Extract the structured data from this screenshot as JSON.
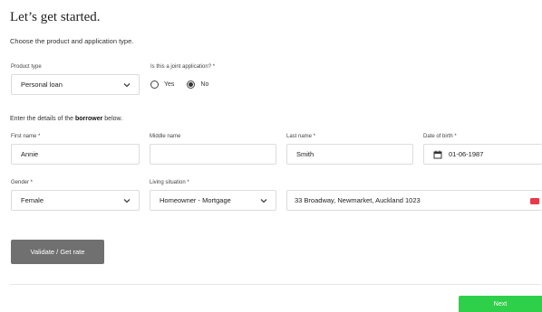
{
  "page": {
    "title": "Let’s get started.",
    "subtitle": "Choose the product and application type."
  },
  "product": {
    "label": "Product type",
    "value": "Personal loan"
  },
  "joint": {
    "label": "Is this a joint application? *",
    "options": [
      "Yes",
      "No"
    ],
    "selected": "No"
  },
  "borrower": {
    "intro_before": "Enter the details of the ",
    "intro_bold": "borrower",
    "intro_after": " below.",
    "first_name": {
      "label": "First name *",
      "value": "Annie"
    },
    "middle_name": {
      "label": "Middle name",
      "value": ""
    },
    "last_name": {
      "label": "Last name *",
      "value": "Smith"
    },
    "dob": {
      "label": "Date of birth *",
      "value": "01-06-1987"
    },
    "gender": {
      "label": "Gender *",
      "value": "Female"
    },
    "living": {
      "label": "Living situation *",
      "value": "Homeowner - Mortgage"
    },
    "address": {
      "value": "33 Broadway, Newmarket, Auckland 1023"
    }
  },
  "actions": {
    "validate_label": "Validate / Get rate",
    "next_label": "Next"
  },
  "colors": {
    "next_button": "#2ed04a",
    "validate_button": "#707070",
    "address_badge": "#e8394a"
  }
}
